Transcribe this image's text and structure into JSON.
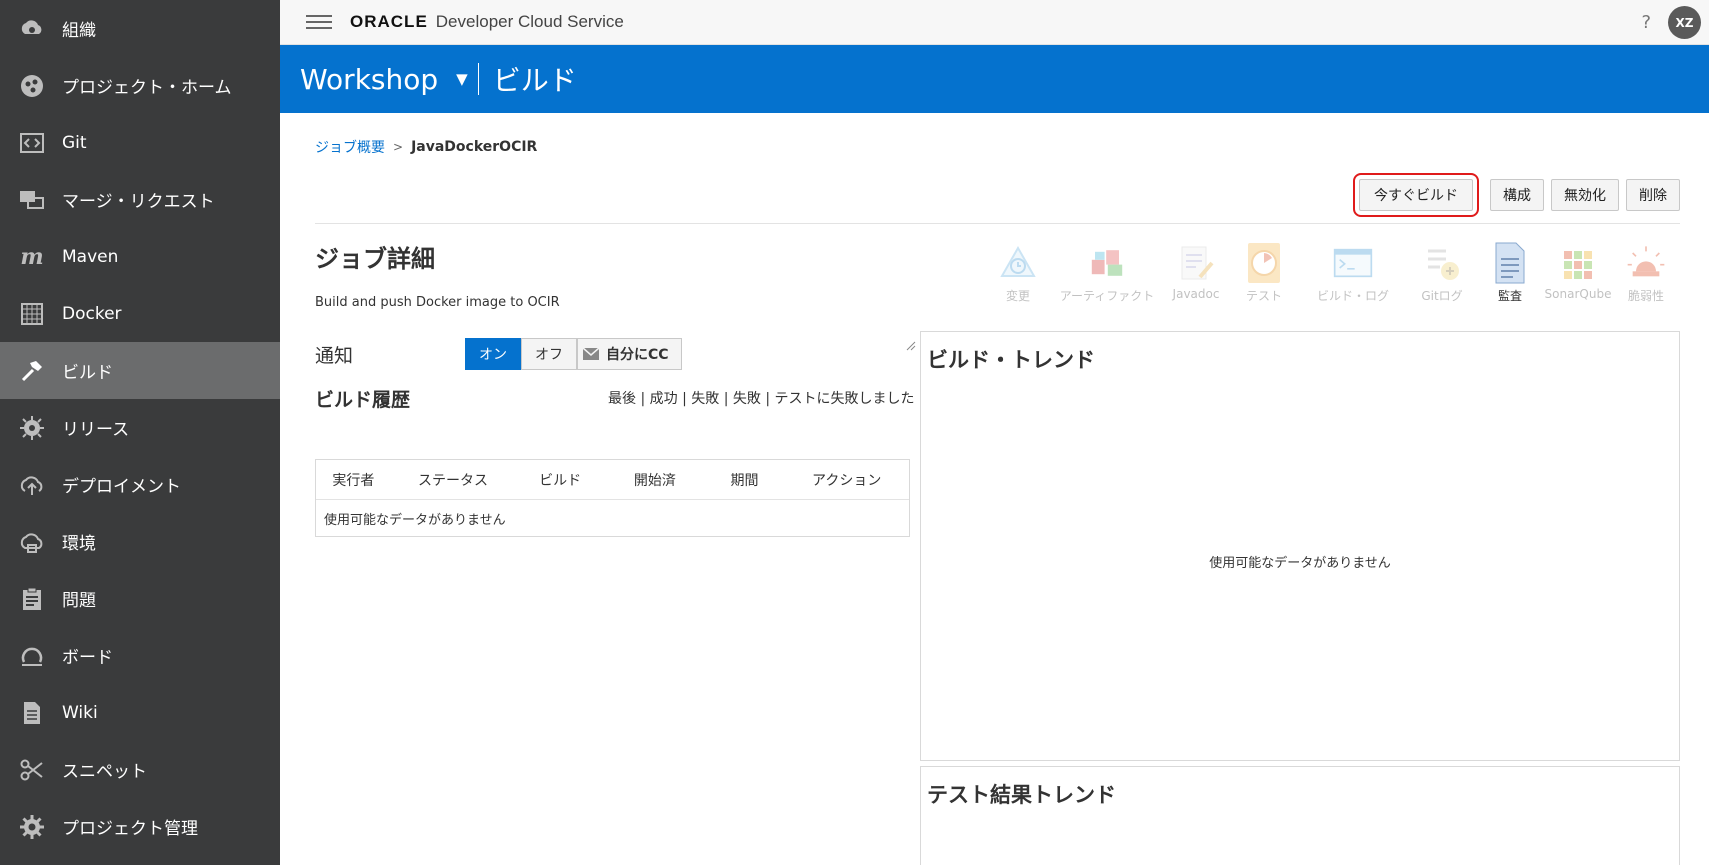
{
  "sidebar": {
    "items": [
      {
        "label": "組織",
        "icon": "organization-icon"
      },
      {
        "label": "プロジェクト・ホーム",
        "icon": "project-home-icon"
      },
      {
        "label": "Git",
        "icon": "git-icon"
      },
      {
        "label": "マージ・リクエスト",
        "icon": "merge-request-icon"
      },
      {
        "label": "Maven",
        "icon": "maven-icon"
      },
      {
        "label": "Docker",
        "icon": "docker-icon"
      },
      {
        "label": "ビルド",
        "icon": "hammer-icon",
        "active": true
      },
      {
        "label": "リリース",
        "icon": "release-icon"
      },
      {
        "label": "デプロイメント",
        "icon": "deployment-icon"
      },
      {
        "label": "環境",
        "icon": "environment-icon"
      },
      {
        "label": "問題",
        "icon": "issues-icon"
      },
      {
        "label": "ボード",
        "icon": "board-icon"
      },
      {
        "label": "Wiki",
        "icon": "wiki-icon"
      },
      {
        "label": "スニペット",
        "icon": "snippet-icon"
      },
      {
        "label": "プロジェクト管理",
        "icon": "gear-icon"
      }
    ]
  },
  "topbar": {
    "logo": "ORACLE",
    "service": "Developer Cloud Service",
    "help": "?",
    "avatar": "XZ"
  },
  "header": {
    "project": "Workshop",
    "section": "ビルド"
  },
  "breadcrumb": {
    "parent": "ジョブ概要",
    "sep": ">",
    "current": "JavaDockerOCIR"
  },
  "actions": {
    "build_now": "今すぐビルド",
    "configure": "構成",
    "disable": "無効化",
    "delete": "削除"
  },
  "job": {
    "title": "ジョブ詳細",
    "description": "Build and push Docker image to OCIR"
  },
  "tools": [
    {
      "label": "変更",
      "icon": "changes-icon"
    },
    {
      "label": "アーティファクト",
      "icon": "artifacts-icon"
    },
    {
      "label": "Javadoc",
      "icon": "javadoc-icon"
    },
    {
      "label": "テスト",
      "icon": "test-icon"
    },
    {
      "label": "ビルド・ログ",
      "icon": "build-log-icon"
    },
    {
      "label": "Gitログ",
      "icon": "git-log-icon"
    },
    {
      "label": "監査",
      "icon": "audit-icon",
      "active": true
    },
    {
      "label": "SonarQube",
      "icon": "sonarqube-icon"
    },
    {
      "label": "脆弱性",
      "icon": "vulnerability-icon"
    }
  ],
  "notify": {
    "label": "通知",
    "on": "オン",
    "off": "オフ",
    "cc": "自分にCC"
  },
  "history": {
    "title": "ビルド履歴",
    "filters": [
      "最後",
      "成功",
      "失敗",
      "失敗",
      "テストに失敗しました"
    ],
    "columns": [
      "実行者",
      "ステータス",
      "ビルド",
      "開始済",
      "期間",
      "アクション"
    ],
    "empty": "使用可能なデータがありません"
  },
  "trend": {
    "title": "ビルド・トレンド",
    "empty": "使用可能なデータがありません"
  },
  "test_trend": {
    "title": "テスト結果トレンド"
  },
  "colors": {
    "accent": "#0572ce",
    "sidebar": "#3a3b3c",
    "sidebar_active": "#6b6c6d",
    "highlight": "#e01b1b"
  }
}
